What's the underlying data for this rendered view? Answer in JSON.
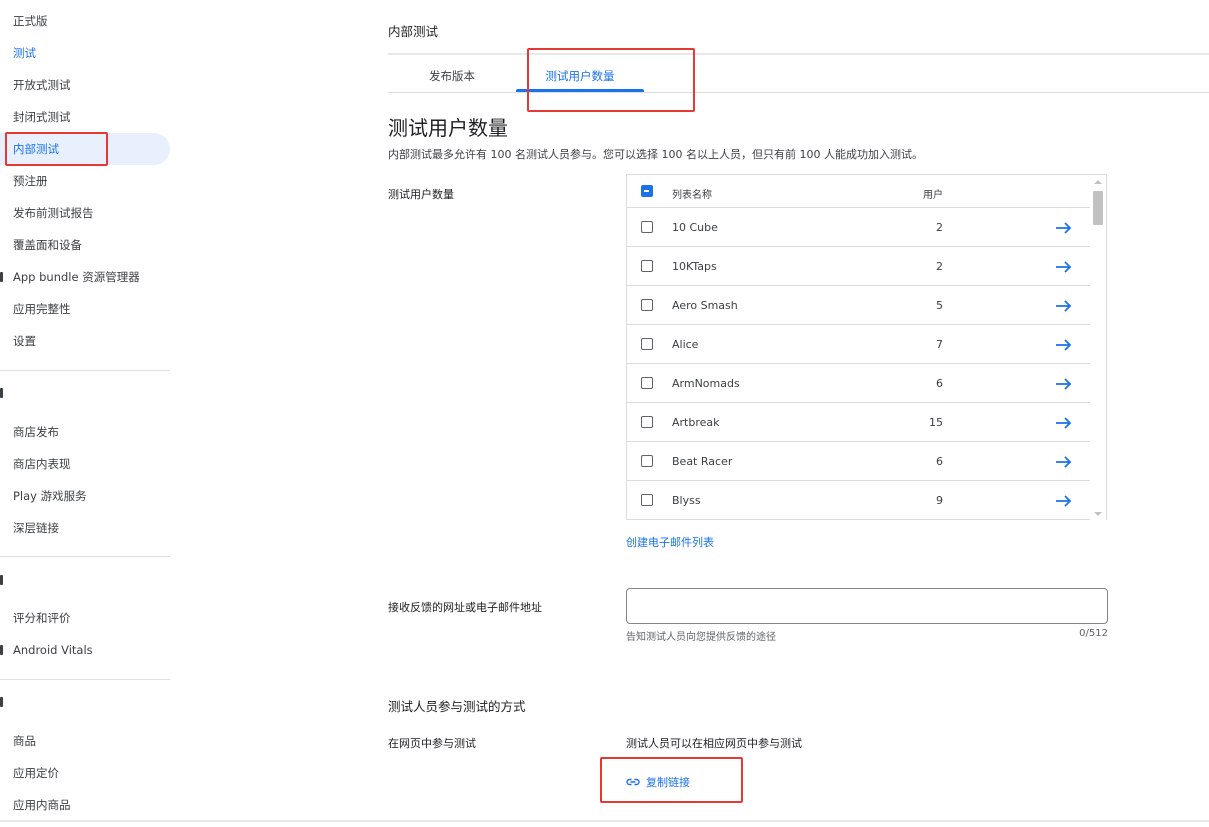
{
  "sidebar": {
    "items": [
      {
        "label": "正式版"
      },
      {
        "label": "测试"
      },
      {
        "label": "开放式测试"
      },
      {
        "label": "封闭式测试"
      },
      {
        "label": "内部测试"
      },
      {
        "label": "预注册"
      },
      {
        "label": "发布前测试报告"
      },
      {
        "label": "覆盖面和设备"
      },
      {
        "label": "App bundle 资源管理器"
      },
      {
        "label": "应用完整性"
      },
      {
        "label": "设置"
      }
    ],
    "section2_items": [
      {
        "label": "商店发布"
      },
      {
        "label": "商店内表现"
      },
      {
        "label": "Play 游戏服务"
      },
      {
        "label": "深层链接"
      }
    ],
    "section3_items": [
      {
        "label": "评分和评价"
      },
      {
        "label": "Android Vitals"
      }
    ],
    "section4_items": [
      {
        "label": "商品"
      },
      {
        "label": "应用定价"
      },
      {
        "label": "应用内商品"
      }
    ]
  },
  "header": {
    "title": "内部测试"
  },
  "tabs": [
    {
      "label": "发布版本"
    },
    {
      "label": "测试用户数量"
    }
  ],
  "page": {
    "title": "测试用户数量",
    "description": "内部测试最多允许有 100 名测试人员参与。您可以选择 100 名以上人员，但只有前 100 人能成功加入测试。"
  },
  "testers": {
    "label": "测试用户数量",
    "columns": {
      "name": "列表名称",
      "users": "用户"
    },
    "rows": [
      {
        "name": "10 Cube",
        "users": "2"
      },
      {
        "name": "10KTaps",
        "users": "2"
      },
      {
        "name": "Aero Smash",
        "users": "5"
      },
      {
        "name": "Alice",
        "users": "7"
      },
      {
        "name": "ArmNomads",
        "users": "6"
      },
      {
        "name": "Artbreak",
        "users": "15"
      },
      {
        "name": "Beat Racer",
        "users": "6"
      },
      {
        "name": "Blyss",
        "users": "9"
      }
    ],
    "create_link": "创建电子邮件列表"
  },
  "feedback": {
    "label": "接收反馈的网址或电子邮件地址",
    "value": "",
    "helper": "告知测试人员向您提供反馈的途径",
    "counter": "0/512"
  },
  "join": {
    "section_title": "测试人员参与测试的方式",
    "web_label": "在网页中参与测试",
    "web_desc": "测试人员可以在相应网页中参与测试",
    "copy_link": "复制链接"
  },
  "colors": {
    "accent": "#1a73e8",
    "active_bg": "#e8f0fe",
    "highlight_box": "#e53935"
  }
}
